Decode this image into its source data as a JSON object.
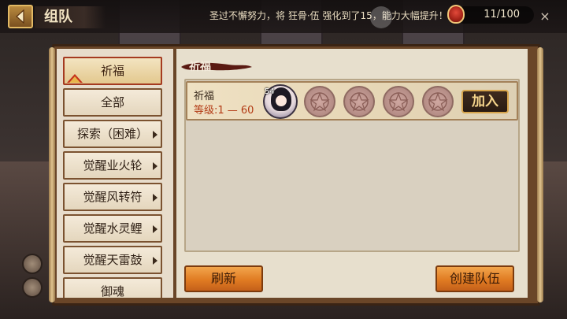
{
  "header": {
    "title": "组队",
    "marquee": "圣过不懈努力，将 狂骨·伍 强化到了15，能力大幅提升！",
    "energy": "11/100"
  },
  "sidebar": {
    "items": [
      {
        "label": "祈福",
        "active": true,
        "has_arrow": false
      },
      {
        "label": "全部",
        "active": false,
        "has_arrow": false
      },
      {
        "label": "探索（困难）",
        "active": false,
        "has_arrow": true
      },
      {
        "label": "觉醒业火轮",
        "active": false,
        "has_arrow": true
      },
      {
        "label": "觉醒风转符",
        "active": false,
        "has_arrow": true
      },
      {
        "label": "觉醒水灵鲤",
        "active": false,
        "has_arrow": true
      },
      {
        "label": "觉醒天雷鼓",
        "active": false,
        "has_arrow": true
      },
      {
        "label": "御魂",
        "active": false,
        "has_arrow": false
      }
    ]
  },
  "content": {
    "section_title": "祈福",
    "teams": [
      {
        "name": "祈福",
        "level_range": "等级:1 — 60",
        "leader_level": "54",
        "empty_slots": 4,
        "join_label": "加入"
      }
    ]
  },
  "buttons": {
    "refresh": "刷新",
    "create_team": "创建队伍"
  },
  "colors": {
    "accent_orange": "#e07b22",
    "level_red": "#b23a14",
    "gold_border": "#d6a44c"
  }
}
